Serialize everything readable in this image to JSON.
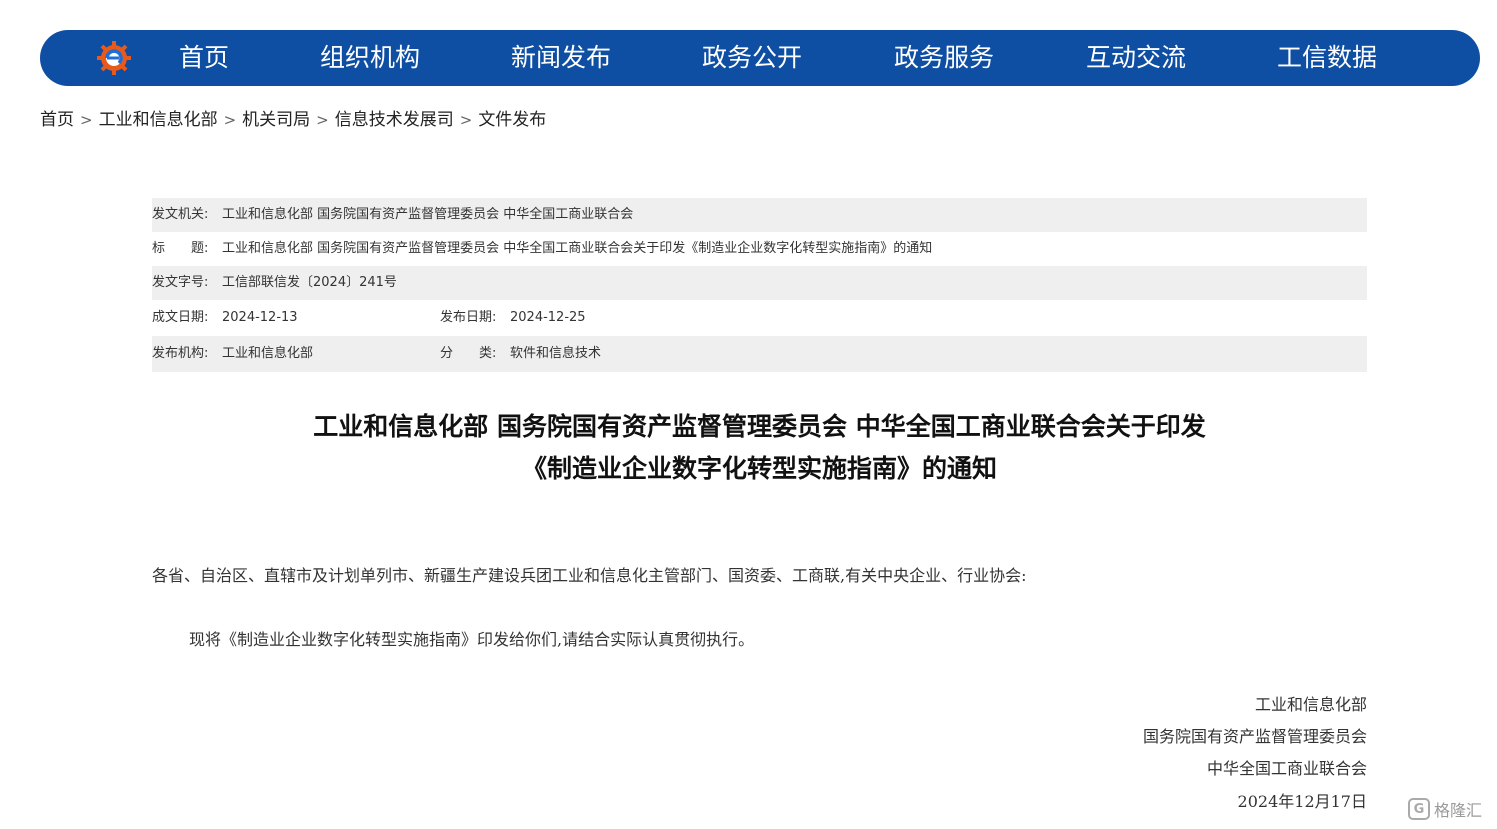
{
  "nav": {
    "items": [
      "首页",
      "组织机构",
      "新闻发布",
      "政务公开",
      "政务服务",
      "互动交流",
      "工信数据"
    ]
  },
  "breadcrumb": [
    "首页",
    "工业和信息化部",
    "机关司局",
    "信息技术发展司",
    "文件发布"
  ],
  "meta": {
    "issuer_label": "发文机关:",
    "issuer_value": "工业和信息化部 国务院国有资产监督管理委员会 中华全国工商业联合会",
    "title_label": "标　　题:",
    "title_value": "工业和信息化部 国务院国有资产监督管理委员会 中华全国工商业联合会关于印发《制造业企业数字化转型实施指南》的通知",
    "docno_label": "发文字号:",
    "docno_value": "工信部联信发〔2024〕241号",
    "written_label": "成文日期:",
    "written_value": "2024-12-13",
    "published_label": "发布日期:",
    "published_value": "2024-12-25",
    "org_label": "发布机构:",
    "org_value": "工业和信息化部",
    "category_label": "分　　类:",
    "category_value": "软件和信息技术"
  },
  "document": {
    "title_line1": "工业和信息化部 国务院国有资产监督管理委员会 中华全国工商业联合会关于印发",
    "title_line2": "《制造业企业数字化转型实施指南》的通知",
    "salutation": "各省、自治区、直辖市及计划单列市、新疆生产建设兵团工业和信息化主管部门、国资委、工商联,有关中央企业、行业协会:",
    "paragraph": "现将《制造业企业数字化转型实施指南》印发给你们,请结合实际认真贯彻执行。",
    "signatures": [
      "工业和信息化部",
      "国务院国有资产监督管理委员会",
      "中华全国工商业联合会"
    ],
    "date": "2024年12月17日"
  },
  "watermark": {
    "icon_text": "G",
    "text": "格隆汇"
  },
  "colors": {
    "nav_background": "#0e4fa3",
    "meta_shade": "#efefef",
    "logo_orange": "#e8591a",
    "logo_blue": "#1d6fd6"
  },
  "icons": {
    "logo": "miit-gear-logo",
    "watermark": "gelonghui-logo-icon"
  }
}
